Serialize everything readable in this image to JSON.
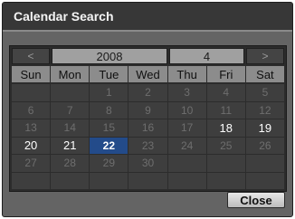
{
  "dialog": {
    "title": "Calendar Search",
    "close_label": "Close"
  },
  "nav": {
    "prev_label": "<",
    "next_label": ">",
    "year": "2008",
    "month": "4"
  },
  "weekdays": [
    "Sun",
    "Mon",
    "Tue",
    "Wed",
    "Thu",
    "Fri",
    "Sat"
  ],
  "days": [
    {
      "label": "",
      "state": "empty"
    },
    {
      "label": "",
      "state": "empty"
    },
    {
      "label": "1",
      "state": "disabled"
    },
    {
      "label": "2",
      "state": "disabled"
    },
    {
      "label": "3",
      "state": "disabled"
    },
    {
      "label": "4",
      "state": "disabled"
    },
    {
      "label": "5",
      "state": "disabled"
    },
    {
      "label": "6",
      "state": "disabled"
    },
    {
      "label": "7",
      "state": "disabled"
    },
    {
      "label": "8",
      "state": "disabled"
    },
    {
      "label": "9",
      "state": "disabled"
    },
    {
      "label": "10",
      "state": "disabled"
    },
    {
      "label": "11",
      "state": "disabled"
    },
    {
      "label": "12",
      "state": "disabled"
    },
    {
      "label": "13",
      "state": "disabled"
    },
    {
      "label": "14",
      "state": "disabled"
    },
    {
      "label": "15",
      "state": "disabled"
    },
    {
      "label": "16",
      "state": "disabled"
    },
    {
      "label": "17",
      "state": "disabled"
    },
    {
      "label": "18",
      "state": "enabled"
    },
    {
      "label": "19",
      "state": "enabled"
    },
    {
      "label": "20",
      "state": "enabled"
    },
    {
      "label": "21",
      "state": "enabled"
    },
    {
      "label": "22",
      "state": "selected"
    },
    {
      "label": "23",
      "state": "disabled"
    },
    {
      "label": "24",
      "state": "disabled"
    },
    {
      "label": "25",
      "state": "disabled"
    },
    {
      "label": "26",
      "state": "disabled"
    },
    {
      "label": "27",
      "state": "disabled"
    },
    {
      "label": "28",
      "state": "disabled"
    },
    {
      "label": "29",
      "state": "disabled"
    },
    {
      "label": "30",
      "state": "disabled"
    },
    {
      "label": "",
      "state": "empty"
    },
    {
      "label": "",
      "state": "empty"
    },
    {
      "label": "",
      "state": "empty"
    },
    {
      "label": "",
      "state": "empty"
    },
    {
      "label": "",
      "state": "empty"
    },
    {
      "label": "",
      "state": "empty"
    },
    {
      "label": "",
      "state": "empty"
    },
    {
      "label": "",
      "state": "empty"
    },
    {
      "label": "",
      "state": "empty"
    },
    {
      "label": "",
      "state": "empty"
    }
  ],
  "colors": {
    "selected": "#234b8a",
    "panel": "#646464",
    "titlebar": "#373737"
  }
}
